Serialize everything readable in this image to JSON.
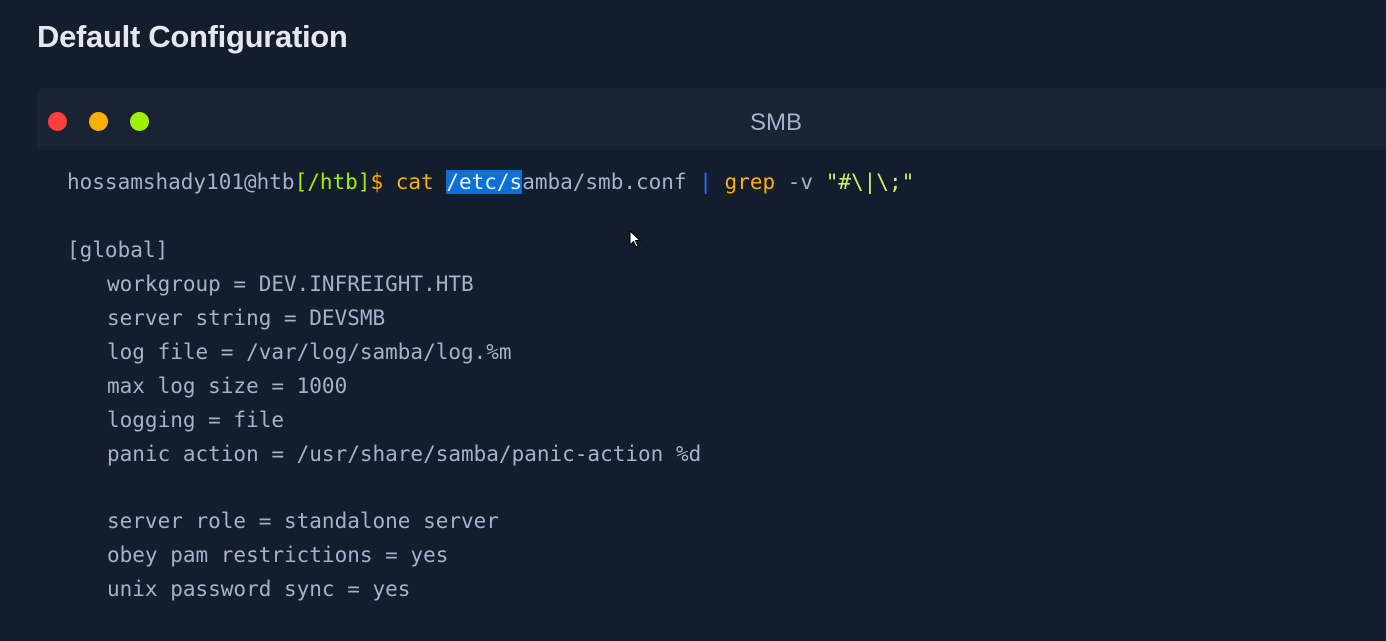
{
  "section": {
    "title": "Default Configuration"
  },
  "terminal": {
    "title": "SMB",
    "prompt": {
      "user": "hossamshady101@htb",
      "path": "[/htb]",
      "symbol": "$",
      "command": "cat",
      "arg_selected": "/etc/s",
      "arg_rest": "amba/smb.conf",
      "pipe": "|",
      "pipe_command": "grep",
      "flag": "-v",
      "pattern": "\"#\\|\\;\""
    },
    "output": {
      "section_header": "[global]",
      "lines_1": [
        "workgroup = DEV.INFREIGHT.HTB",
        "server string = DEVSMB",
        "log file = /var/log/samba/log.%m",
        "max log size = 1000",
        "logging = file",
        "panic action = /usr/share/samba/panic-action %d"
      ],
      "lines_2": [
        "server role = standalone server",
        "obey pam restrictions = yes",
        "unix password sync = yes"
      ]
    }
  },
  "colors": {
    "background": "#141d2b",
    "prompt_path": "#9fef00",
    "command": "#ffaf00",
    "selection": "#0a6fd6",
    "string": "#c5f467"
  }
}
